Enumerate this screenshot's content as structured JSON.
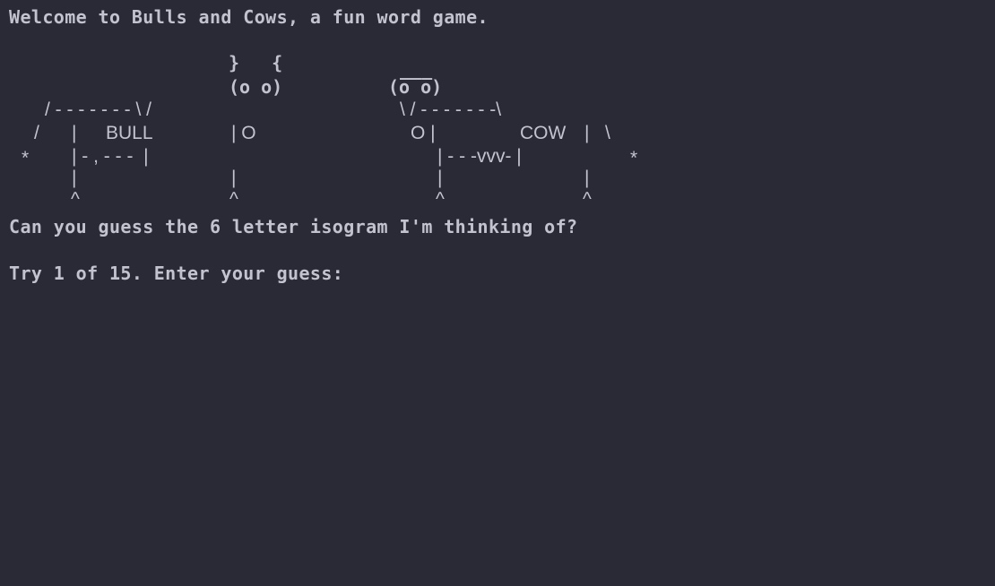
{
  "terminal": {
    "welcome": "Welcome to Bulls and Cows, a fun word game.",
    "question": "Can you guess the 6 letter isogram I'm thinking of?",
    "prompt": "Try 1 of 15. Enter your guess:",
    "input_value": ""
  },
  "art": {
    "bull_horns": "}   {",
    "bull_face": "(o o)",
    "bull_back": "/ - - - - - - - \\ /",
    "bull_front_leg_slash": "/",
    "bull_label": "BULL",
    "bull_body_left": "|",
    "bull_body_right": "| O",
    "bull_tail": "*",
    "bull_belly": "| - , - - -  |",
    "bull_leg_left": "|",
    "bull_leg_right": "|",
    "bull_hoof_left": "^",
    "bull_hoof_right": "^",
    "cow_top": "___",
    "cow_face": "(o o)",
    "cow_back": "\\ / - - - - - - -\\",
    "cow_nose": "O |",
    "cow_label": "COW",
    "cow_body_right": "|   \\",
    "cow_belly": "| - - -vvv- |",
    "cow_tail": "*",
    "cow_leg_left": "|",
    "cow_leg_right": "|",
    "cow_hoof_left": "^",
    "cow_hoof_right": "^"
  },
  "colors": {
    "background": "#292a35",
    "text": "#c3c3d0"
  }
}
